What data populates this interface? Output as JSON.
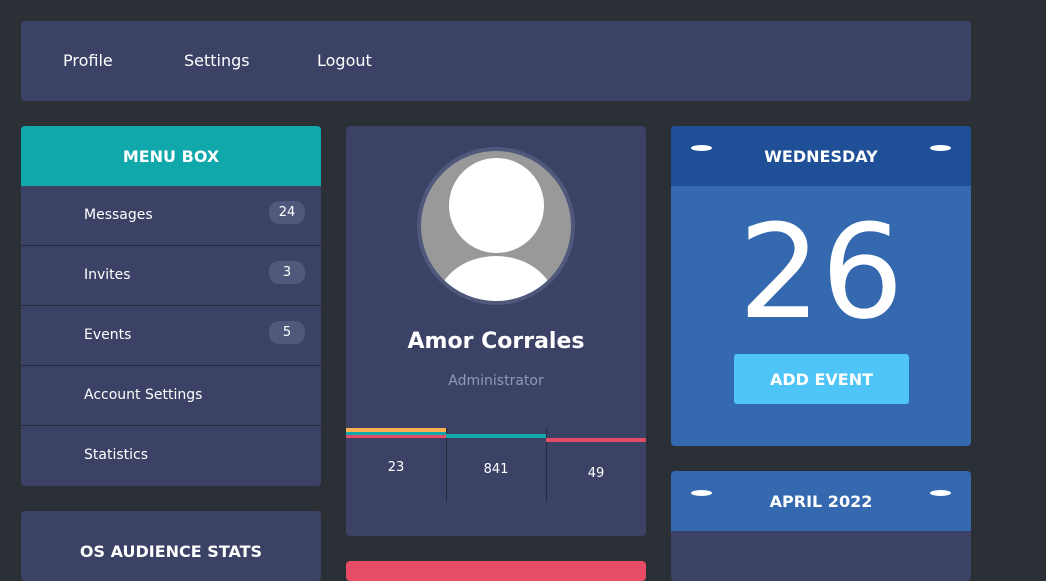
{
  "nav": {
    "items": [
      "Profile",
      "Settings",
      "Logout"
    ]
  },
  "menu": {
    "title": "MENU BOX",
    "items": [
      {
        "label": "Messages",
        "badge": "24"
      },
      {
        "label": "Invites",
        "badge": "3"
      },
      {
        "label": "Events",
        "badge": "5"
      },
      {
        "label": "Account Settings"
      },
      {
        "label": "Statistics"
      }
    ]
  },
  "os_stats": {
    "title": "OS AUDIENCE STATS"
  },
  "profile": {
    "name": "Amor Corrales",
    "role": "Administrator",
    "stats": [
      {
        "value": "23",
        "color": "#fcb150"
      },
      {
        "value": "841",
        "color": "#11a8ab"
      },
      {
        "value": "49",
        "color": "#e64c65"
      }
    ]
  },
  "calendar": {
    "weekday": "WEDNESDAY",
    "day": "26",
    "add_event_label": "ADD EVENT",
    "month_title": "APRIL 2022"
  },
  "colors": {
    "background": "#2b3036",
    "panel": "#3b4266",
    "teal": "#11a8ab",
    "blue": "#3468af",
    "red": "#e64c65",
    "orange": "#fcb150"
  }
}
